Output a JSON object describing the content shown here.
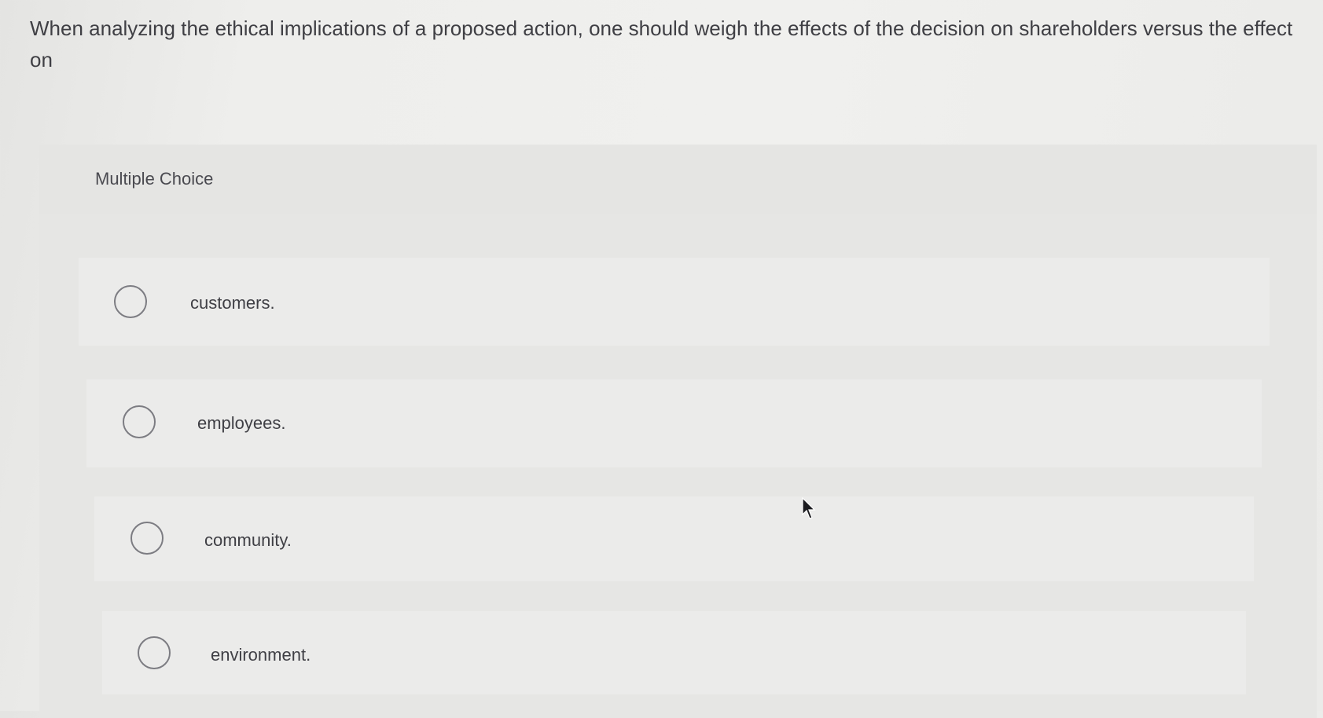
{
  "question": {
    "text": "When analyzing the ethical implications of a proposed action, one should weigh the effects of the decision on shareholders versus the effect on"
  },
  "panel": {
    "label": "Multiple Choice"
  },
  "options": [
    {
      "label": "customers.",
      "selected": false
    },
    {
      "label": "employees.",
      "selected": false
    },
    {
      "label": "community.",
      "selected": false
    },
    {
      "label": "environment.",
      "selected": false
    }
  ],
  "cursor": {
    "icon": "arrow-pointer-icon"
  }
}
